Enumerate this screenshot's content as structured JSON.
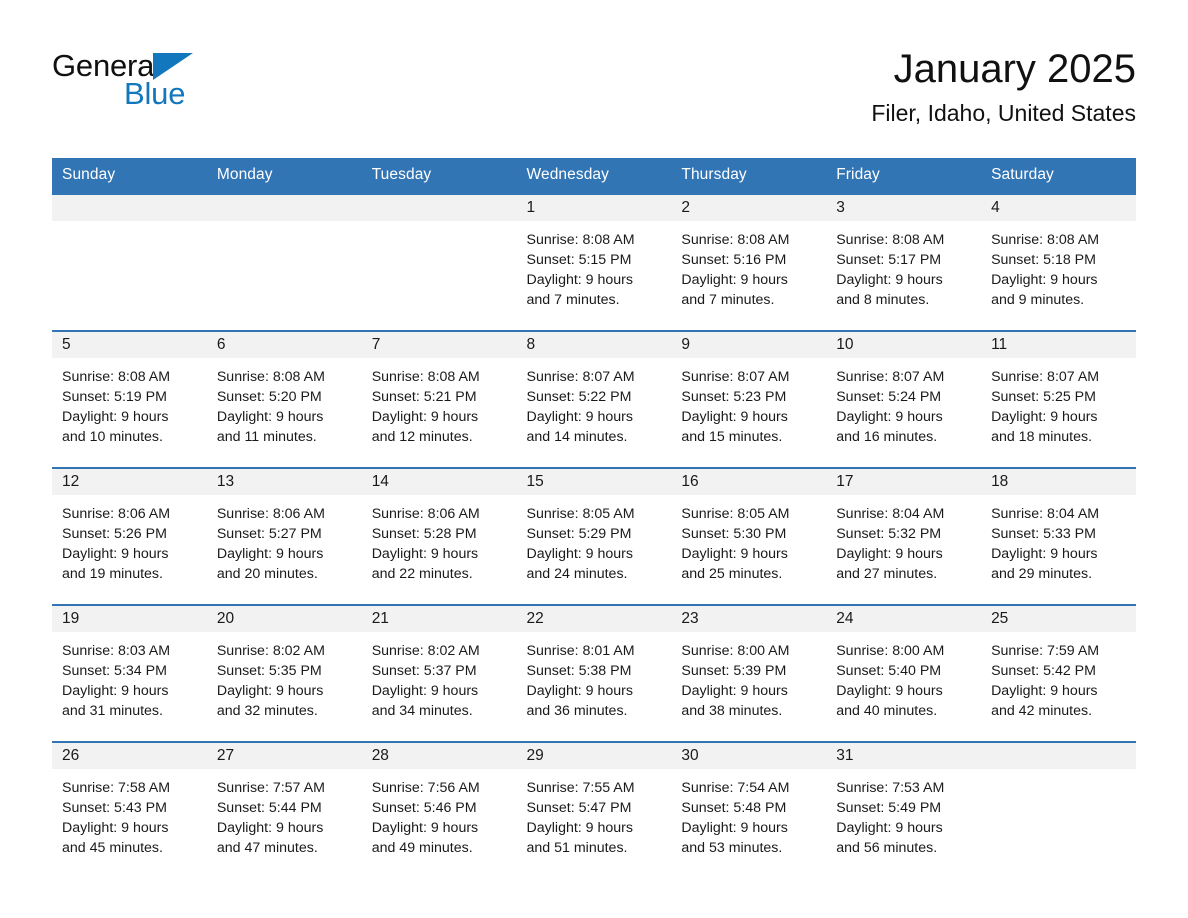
{
  "brand": {
    "line1": "General",
    "line2": "Blue",
    "triangle_color": "#1277bc",
    "text_color": "#101010"
  },
  "header": {
    "title": "January 2025",
    "subtitle": "Filer, Idaho, United States"
  },
  "theme": {
    "header_bg": "#3275b5",
    "header_text": "#ffffff",
    "daynum_band": "#f2f2f2",
    "row_divider": "#3275b5"
  },
  "calendar": {
    "weekday_headers": [
      "Sunday",
      "Monday",
      "Tuesday",
      "Wednesday",
      "Thursday",
      "Friday",
      "Saturday"
    ],
    "weeks": [
      [
        {
          "day": "",
          "lines": []
        },
        {
          "day": "",
          "lines": []
        },
        {
          "day": "",
          "lines": []
        },
        {
          "day": "1",
          "lines": [
            "Sunrise: 8:08 AM",
            "Sunset: 5:15 PM",
            "Daylight: 9 hours",
            "and 7 minutes."
          ]
        },
        {
          "day": "2",
          "lines": [
            "Sunrise: 8:08 AM",
            "Sunset: 5:16 PM",
            "Daylight: 9 hours",
            "and 7 minutes."
          ]
        },
        {
          "day": "3",
          "lines": [
            "Sunrise: 8:08 AM",
            "Sunset: 5:17 PM",
            "Daylight: 9 hours",
            "and 8 minutes."
          ]
        },
        {
          "day": "4",
          "lines": [
            "Sunrise: 8:08 AM",
            "Sunset: 5:18 PM",
            "Daylight: 9 hours",
            "and 9 minutes."
          ]
        }
      ],
      [
        {
          "day": "5",
          "lines": [
            "Sunrise: 8:08 AM",
            "Sunset: 5:19 PM",
            "Daylight: 9 hours",
            "and 10 minutes."
          ]
        },
        {
          "day": "6",
          "lines": [
            "Sunrise: 8:08 AM",
            "Sunset: 5:20 PM",
            "Daylight: 9 hours",
            "and 11 minutes."
          ]
        },
        {
          "day": "7",
          "lines": [
            "Sunrise: 8:08 AM",
            "Sunset: 5:21 PM",
            "Daylight: 9 hours",
            "and 12 minutes."
          ]
        },
        {
          "day": "8",
          "lines": [
            "Sunrise: 8:07 AM",
            "Sunset: 5:22 PM",
            "Daylight: 9 hours",
            "and 14 minutes."
          ]
        },
        {
          "day": "9",
          "lines": [
            "Sunrise: 8:07 AM",
            "Sunset: 5:23 PM",
            "Daylight: 9 hours",
            "and 15 minutes."
          ]
        },
        {
          "day": "10",
          "lines": [
            "Sunrise: 8:07 AM",
            "Sunset: 5:24 PM",
            "Daylight: 9 hours",
            "and 16 minutes."
          ]
        },
        {
          "day": "11",
          "lines": [
            "Sunrise: 8:07 AM",
            "Sunset: 5:25 PM",
            "Daylight: 9 hours",
            "and 18 minutes."
          ]
        }
      ],
      [
        {
          "day": "12",
          "lines": [
            "Sunrise: 8:06 AM",
            "Sunset: 5:26 PM",
            "Daylight: 9 hours",
            "and 19 minutes."
          ]
        },
        {
          "day": "13",
          "lines": [
            "Sunrise: 8:06 AM",
            "Sunset: 5:27 PM",
            "Daylight: 9 hours",
            "and 20 minutes."
          ]
        },
        {
          "day": "14",
          "lines": [
            "Sunrise: 8:06 AM",
            "Sunset: 5:28 PM",
            "Daylight: 9 hours",
            "and 22 minutes."
          ]
        },
        {
          "day": "15",
          "lines": [
            "Sunrise: 8:05 AM",
            "Sunset: 5:29 PM",
            "Daylight: 9 hours",
            "and 24 minutes."
          ]
        },
        {
          "day": "16",
          "lines": [
            "Sunrise: 8:05 AM",
            "Sunset: 5:30 PM",
            "Daylight: 9 hours",
            "and 25 minutes."
          ]
        },
        {
          "day": "17",
          "lines": [
            "Sunrise: 8:04 AM",
            "Sunset: 5:32 PM",
            "Daylight: 9 hours",
            "and 27 minutes."
          ]
        },
        {
          "day": "18",
          "lines": [
            "Sunrise: 8:04 AM",
            "Sunset: 5:33 PM",
            "Daylight: 9 hours",
            "and 29 minutes."
          ]
        }
      ],
      [
        {
          "day": "19",
          "lines": [
            "Sunrise: 8:03 AM",
            "Sunset: 5:34 PM",
            "Daylight: 9 hours",
            "and 31 minutes."
          ]
        },
        {
          "day": "20",
          "lines": [
            "Sunrise: 8:02 AM",
            "Sunset: 5:35 PM",
            "Daylight: 9 hours",
            "and 32 minutes."
          ]
        },
        {
          "day": "21",
          "lines": [
            "Sunrise: 8:02 AM",
            "Sunset: 5:37 PM",
            "Daylight: 9 hours",
            "and 34 minutes."
          ]
        },
        {
          "day": "22",
          "lines": [
            "Sunrise: 8:01 AM",
            "Sunset: 5:38 PM",
            "Daylight: 9 hours",
            "and 36 minutes."
          ]
        },
        {
          "day": "23",
          "lines": [
            "Sunrise: 8:00 AM",
            "Sunset: 5:39 PM",
            "Daylight: 9 hours",
            "and 38 minutes."
          ]
        },
        {
          "day": "24",
          "lines": [
            "Sunrise: 8:00 AM",
            "Sunset: 5:40 PM",
            "Daylight: 9 hours",
            "and 40 minutes."
          ]
        },
        {
          "day": "25",
          "lines": [
            "Sunrise: 7:59 AM",
            "Sunset: 5:42 PM",
            "Daylight: 9 hours",
            "and 42 minutes."
          ]
        }
      ],
      [
        {
          "day": "26",
          "lines": [
            "Sunrise: 7:58 AM",
            "Sunset: 5:43 PM",
            "Daylight: 9 hours",
            "and 45 minutes."
          ]
        },
        {
          "day": "27",
          "lines": [
            "Sunrise: 7:57 AM",
            "Sunset: 5:44 PM",
            "Daylight: 9 hours",
            "and 47 minutes."
          ]
        },
        {
          "day": "28",
          "lines": [
            "Sunrise: 7:56 AM",
            "Sunset: 5:46 PM",
            "Daylight: 9 hours",
            "and 49 minutes."
          ]
        },
        {
          "day": "29",
          "lines": [
            "Sunrise: 7:55 AM",
            "Sunset: 5:47 PM",
            "Daylight: 9 hours",
            "and 51 minutes."
          ]
        },
        {
          "day": "30",
          "lines": [
            "Sunrise: 7:54 AM",
            "Sunset: 5:48 PM",
            "Daylight: 9 hours",
            "and 53 minutes."
          ]
        },
        {
          "day": "31",
          "lines": [
            "Sunrise: 7:53 AM",
            "Sunset: 5:49 PM",
            "Daylight: 9 hours",
            "and 56 minutes."
          ]
        },
        {
          "day": "",
          "lines": []
        }
      ]
    ]
  }
}
